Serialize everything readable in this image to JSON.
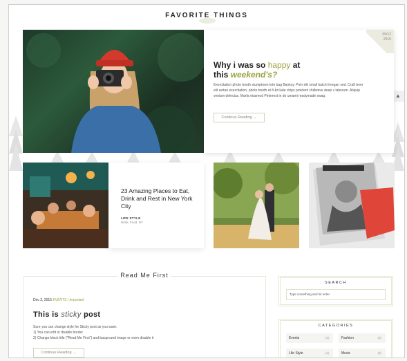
{
  "site": {
    "title": "FAVORITE THINGS"
  },
  "hero": {
    "date": [
      "09/12",
      "2015"
    ],
    "title_pre": "Why i was so ",
    "title_hl1": "happy",
    "title_mid": " at",
    "title_line2_pre": "this ",
    "title_hl2": "weekend's?",
    "text": "Exercitation photo booth stumptown tote bag Banksy. Poin elit small batch freegan sed. Craft beer elit seitan exercitation, photo booth et 8-bit kale chips proident chillwave deep v laborum. Aliquip veniam delectus. Marfa eiusmod Pinterest in do umami readymade swag.",
    "button": "Continue Reading →"
  },
  "card2": {
    "title": "23 Amazing Places to Eat, Drink and Rest in New York City",
    "category": "LIFE STYLE",
    "tags": "Drink, Food, NY"
  },
  "sticky": {
    "section_title": "Read Me First",
    "date": "Dec 2, 2015",
    "cats": "EVENTS / Important",
    "title_pre": "This is ",
    "title_it": "sticky",
    "title_post": " post",
    "line1": "Sure you can change style for Sticky post as you want.",
    "line2": "1) You can edit or disable border",
    "line3": "2) Change block title (\"Read Me First\") and bacground image or even disable it",
    "button": "Continue Reading →"
  },
  "sidebar": {
    "search_title": "SEARCH",
    "search_value": "Type something and hit enter",
    "categories_title": "CATEGORIES",
    "categories": [
      {
        "label": "Events",
        "count": "(4)"
      },
      {
        "label": "Fashion",
        "count": "(3)"
      },
      {
        "label": "Life Style",
        "count": "(4)"
      },
      {
        "label": "Music",
        "count": "(3)"
      }
    ]
  },
  "colors": {
    "accent": "#9aa23f",
    "border": "#e5e8d2"
  },
  "icons": {
    "scroll_up": "chevron-up-icon"
  }
}
